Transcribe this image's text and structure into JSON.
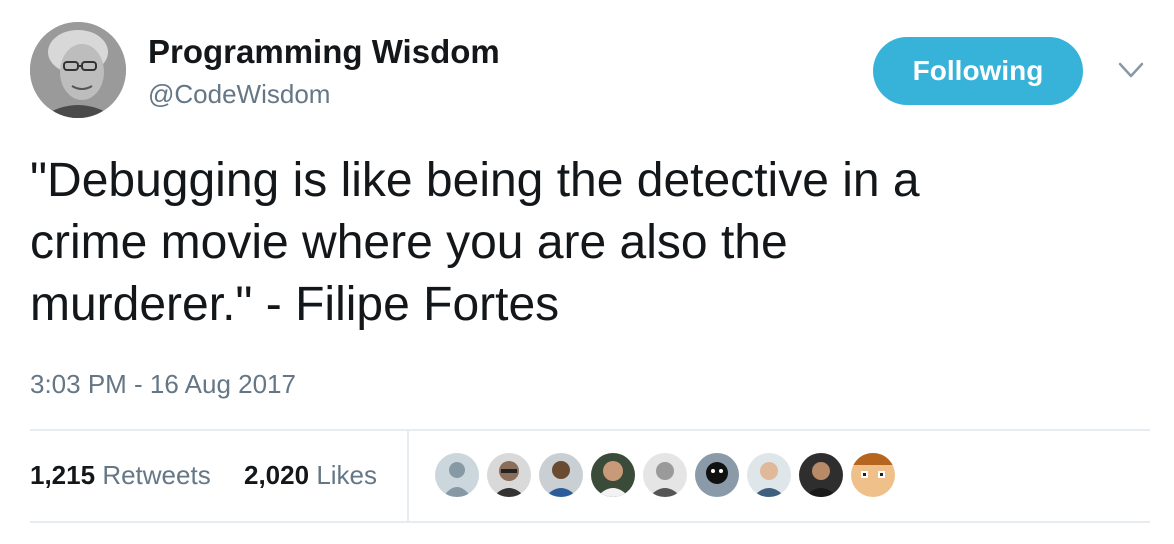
{
  "account": {
    "display_name": "Programming Wisdom",
    "handle": "@CodeWisdom",
    "avatar_icon": "profile-photo-icon"
  },
  "follow_button": {
    "label": "Following",
    "color": "#37b2d8"
  },
  "menu": {
    "icon": "chevron-down-icon"
  },
  "tweet": {
    "text": "\"Debugging is like being the detective in a\ncrime movie where you are also the\nmurderer.\" - Filipe Fortes",
    "timestamp": "3:03 PM - 16 Aug 2017"
  },
  "stats": {
    "retweets_count": "1,215",
    "retweets_label": "Retweets",
    "likes_count": "2,020",
    "likes_label": "Likes"
  },
  "likers": [
    {
      "icon": "default-avatar-icon"
    },
    {
      "icon": "user-avatar-icon"
    },
    {
      "icon": "user-avatar-icon"
    },
    {
      "icon": "user-avatar-icon"
    },
    {
      "icon": "user-avatar-icon"
    },
    {
      "icon": "user-avatar-icon"
    },
    {
      "icon": "user-avatar-icon"
    },
    {
      "icon": "user-avatar-icon"
    },
    {
      "icon": "pixel-face-avatar-icon"
    }
  ],
  "colors": {
    "text": "#14171a",
    "secondary": "#657786",
    "divider": "#e6ecf0"
  }
}
